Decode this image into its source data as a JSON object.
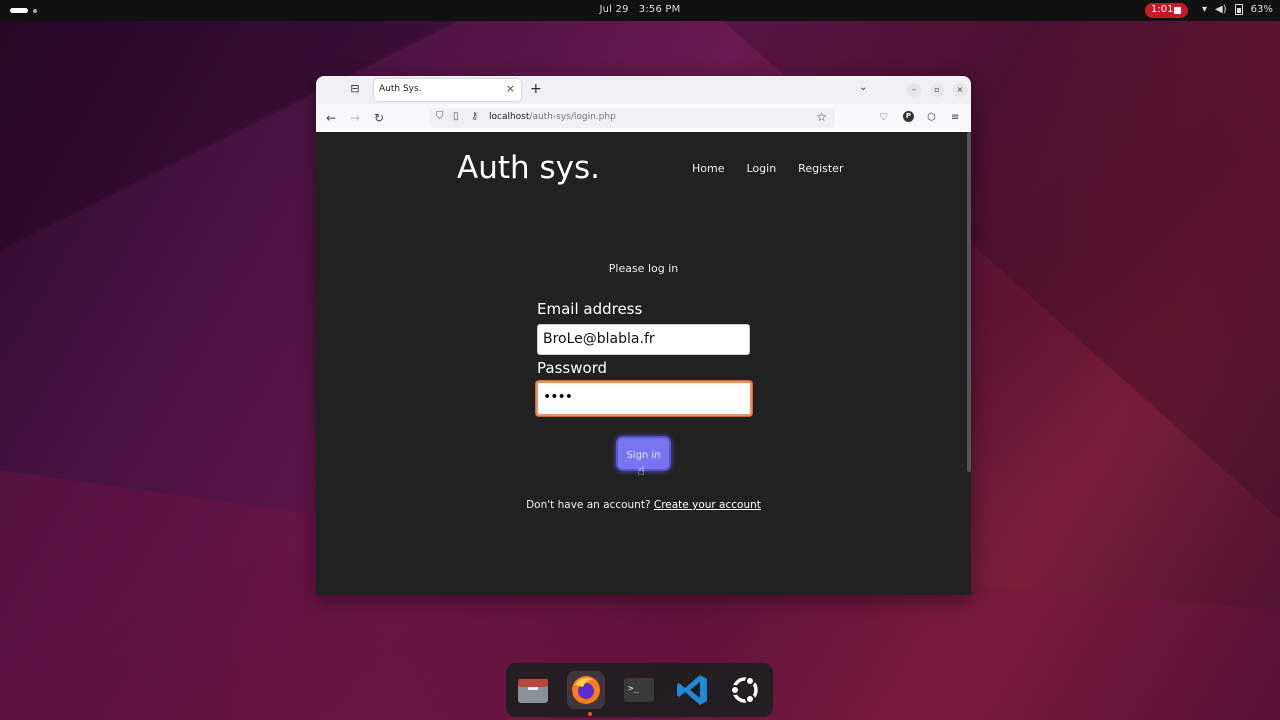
{
  "topbar": {
    "date": "Jul 29",
    "time": "3:56 PM",
    "recording": "1:01",
    "battery": "63%",
    "icons": [
      "activities-icon",
      "wifi-icon",
      "volume-icon",
      "battery-icon"
    ]
  },
  "browser": {
    "tab_title": "Auth Sys.",
    "url_host": "localhost",
    "url_path": "/auth-sys/login.php"
  },
  "site": {
    "brand": "Auth sys.",
    "nav": [
      "Home",
      "Login",
      "Register"
    ],
    "prompt": "Please log in",
    "email_label": "Email address",
    "email_value": "BroLe@blabla.fr",
    "password_label": "Password",
    "password_value": "••••",
    "signin_label": "Sign in",
    "footer_text": "Don't have an account?",
    "footer_link": "Create your account"
  },
  "dock": {
    "apps": [
      "files-icon",
      "firefox-icon",
      "terminal-icon",
      "vscode-icon",
      "ubuntu-icon"
    ],
    "accent": "#e95420"
  }
}
